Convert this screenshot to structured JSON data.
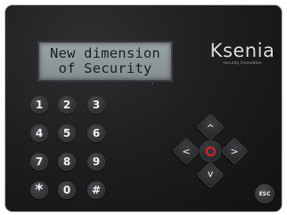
{
  "display": {
    "line1": "New dimension",
    "line2": "of Security"
  },
  "brand": {
    "logo": "Ksenia",
    "tagline": "security innovation"
  },
  "keypad": {
    "k1": "1",
    "k2": "2",
    "k3": "3",
    "k4": "4",
    "k5": "5",
    "k6": "6",
    "k7": "7",
    "k8": "8",
    "k9": "9",
    "kstar": "*",
    "k0": "0",
    "khash": "#"
  },
  "nav": {
    "up": "^",
    "down": "v",
    "left": "<",
    "right": ">",
    "ok_icon": "red-ring-icon"
  },
  "esc_label": "ESC",
  "colors": {
    "panel": "#1b1c1e",
    "lcd": "#8f989b",
    "ok_ring": "#e01f26"
  }
}
